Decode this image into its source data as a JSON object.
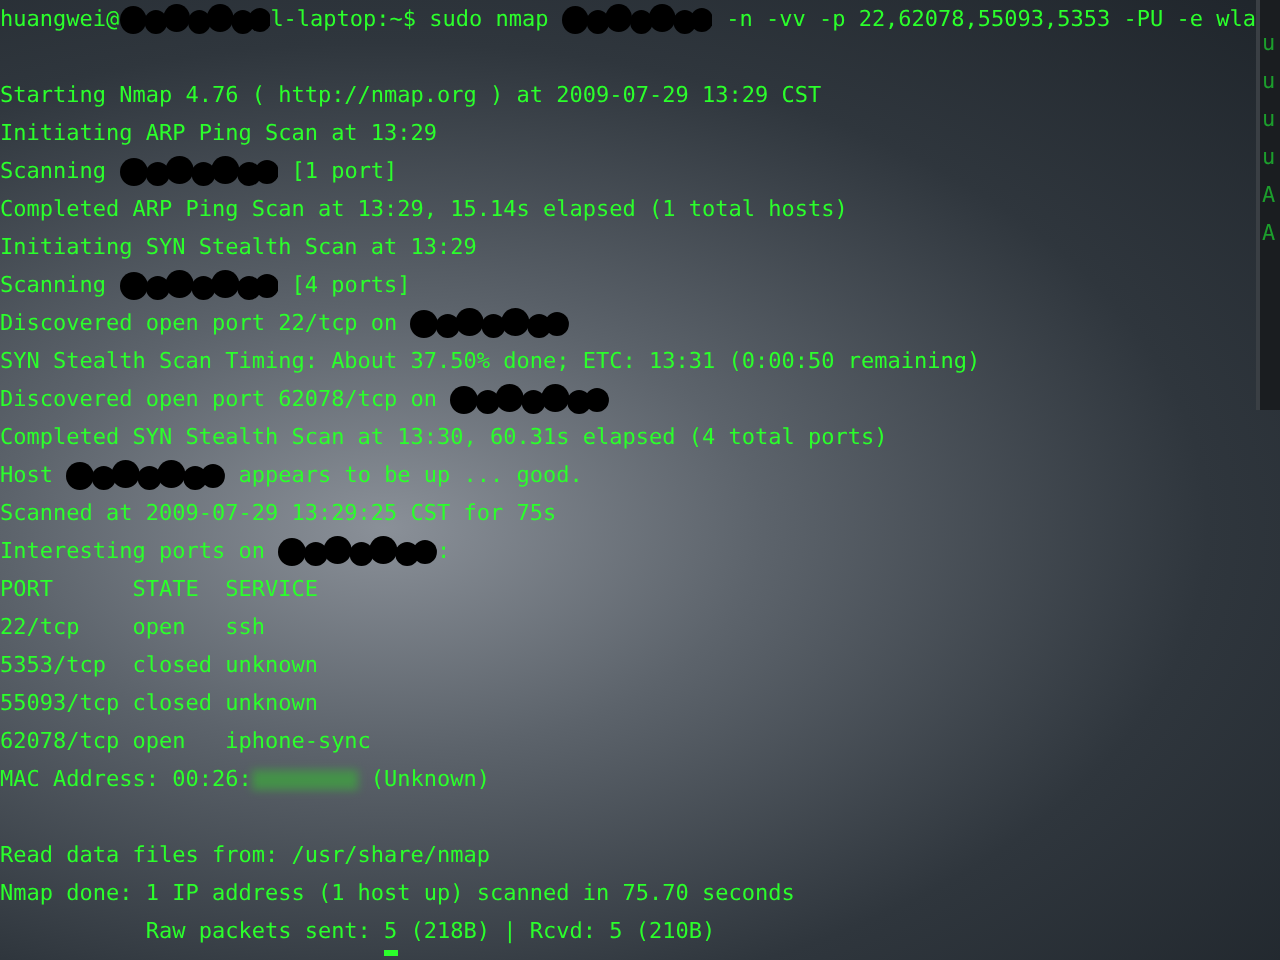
{
  "terminal": {
    "lines": [
      {
        "segments": [
          {
            "kind": "text",
            "text": "huangwei@"
          },
          {
            "kind": "redacted"
          },
          {
            "kind": "text",
            "text": "l-laptop:~$ sudo nmap "
          },
          {
            "kind": "redacted"
          },
          {
            "kind": "text",
            "text": " -n -vv -p 22,62078,55093,5353 -PU -e wla"
          }
        ]
      },
      {
        "gap_before": true,
        "segments": [
          {
            "kind": "text",
            "text": "Starting Nmap 4.76 ( http://nmap.org ) at 2009-07-29 13:29 CST"
          }
        ]
      },
      {
        "segments": [
          {
            "kind": "text",
            "text": "Initiating ARP Ping Scan at 13:29"
          }
        ]
      },
      {
        "segments": [
          {
            "kind": "text",
            "text": "Scanning "
          },
          {
            "kind": "redacted"
          },
          {
            "kind": "text",
            "text": " [1 port]"
          }
        ]
      },
      {
        "segments": [
          {
            "kind": "text",
            "text": "Completed ARP Ping Scan at 13:29, 15.14s elapsed (1 total hosts)"
          }
        ]
      },
      {
        "segments": [
          {
            "kind": "text",
            "text": "Initiating SYN Stealth Scan at 13:29"
          }
        ]
      },
      {
        "segments": [
          {
            "kind": "text",
            "text": "Scanning "
          },
          {
            "kind": "redacted"
          },
          {
            "kind": "text",
            "text": " [4 ports]"
          }
        ]
      },
      {
        "segments": [
          {
            "kind": "text",
            "text": "Discovered open port 22/tcp on "
          },
          {
            "kind": "redacted"
          }
        ]
      },
      {
        "segments": [
          {
            "kind": "text",
            "text": "SYN Stealth Scan Timing: About 37.50% done; ETC: 13:31 (0:00:50 remaining)"
          }
        ]
      },
      {
        "segments": [
          {
            "kind": "text",
            "text": "Discovered open port 62078/tcp on "
          },
          {
            "kind": "redacted"
          }
        ]
      },
      {
        "segments": [
          {
            "kind": "text",
            "text": "Completed SYN Stealth Scan at 13:30, 60.31s elapsed (4 total ports)"
          }
        ]
      },
      {
        "segments": [
          {
            "kind": "text",
            "text": "Host "
          },
          {
            "kind": "redacted"
          },
          {
            "kind": "text",
            "text": " appears to be up ... good."
          }
        ]
      },
      {
        "segments": [
          {
            "kind": "text",
            "text": "Scanned at 2009-07-29 13:29:25 CST for 75s"
          }
        ]
      },
      {
        "segments": [
          {
            "kind": "text",
            "text": "Interesting ports on "
          },
          {
            "kind": "redacted"
          },
          {
            "kind": "text",
            "text": ":"
          }
        ]
      },
      {
        "segments": [
          {
            "kind": "text",
            "text": "PORT      STATE  SERVICE"
          }
        ]
      },
      {
        "segments": [
          {
            "kind": "text",
            "text": "22/tcp    open   ssh"
          }
        ]
      },
      {
        "segments": [
          {
            "kind": "text",
            "text": "5353/tcp  closed unknown"
          }
        ]
      },
      {
        "segments": [
          {
            "kind": "text",
            "text": "55093/tcp closed unknown"
          }
        ]
      },
      {
        "segments": [
          {
            "kind": "text",
            "text": "62078/tcp open   iphone-sync"
          }
        ]
      },
      {
        "segments": [
          {
            "kind": "text",
            "text": "MAC Address: 00:26:"
          },
          {
            "kind": "blurred"
          },
          {
            "kind": "text",
            "text": " (Unknown)"
          }
        ]
      },
      {
        "gap_before": true,
        "segments": [
          {
            "kind": "text",
            "text": "Read data files from: /usr/share/nmap"
          }
        ]
      },
      {
        "segments": [
          {
            "kind": "text",
            "text": "Nmap done: 1 IP address (1 host up) scanned in 75.70 seconds"
          }
        ]
      },
      {
        "segments": [
          {
            "kind": "text",
            "text": "           Raw packets sent: 5 (218B) | Rcvd: 5 (210B)"
          }
        ]
      }
    ]
  },
  "background_window": {
    "lines": [
      "u",
      "u",
      "u",
      "u",
      "A",
      "A"
    ]
  }
}
